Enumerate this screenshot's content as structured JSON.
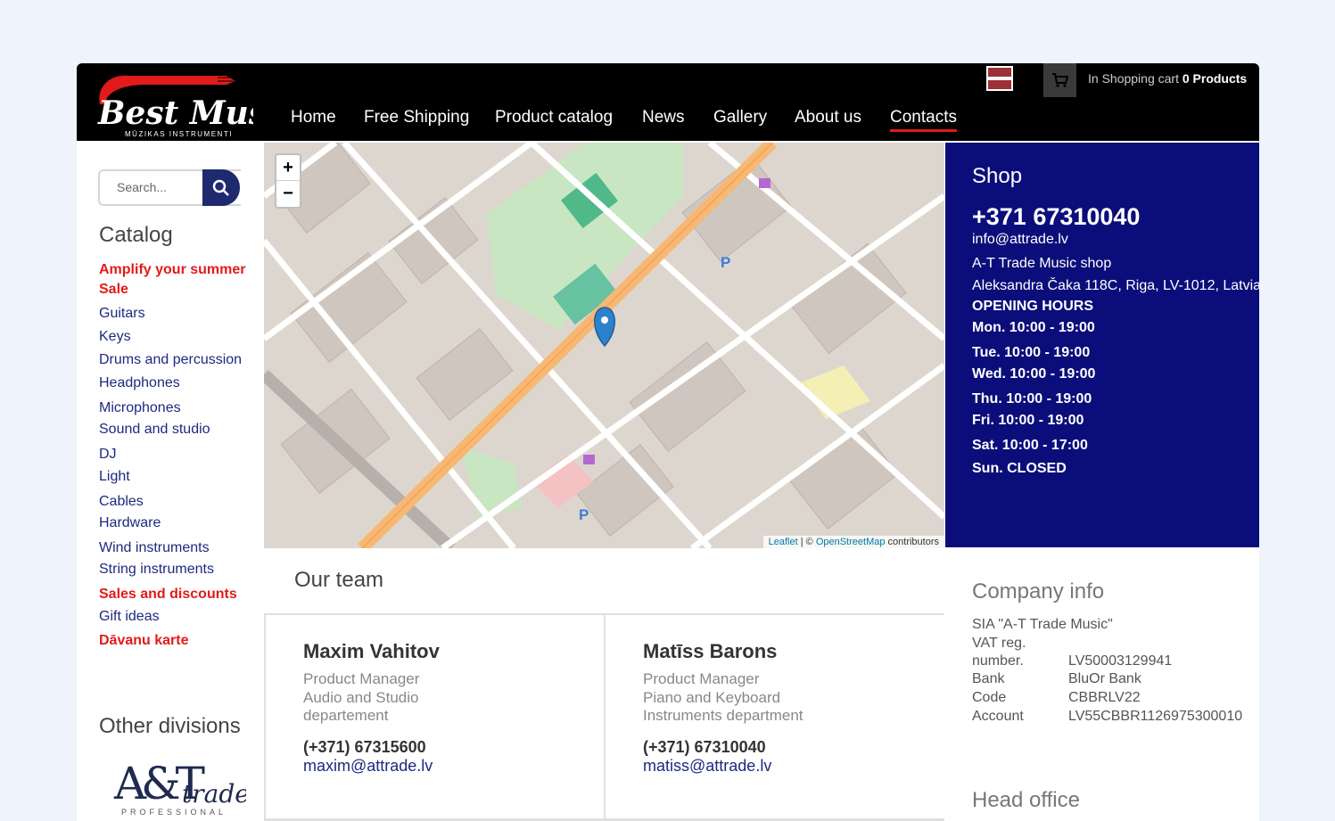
{
  "header": {
    "logo_text": "Best Music",
    "logo_subtext": "MŪZIKAS INSTRUMENTI",
    "nav": [
      "Home",
      "Free Shipping",
      "Product catalog",
      "News",
      "Gallery",
      "About us",
      "Contacts"
    ],
    "active_nav": "Contacts",
    "cart_label": "In Shopping cart",
    "cart_count": "0 Products",
    "language_flag": "latvia-flag"
  },
  "sidebar": {
    "search_placeholder": "Search...",
    "catalog_title": "Catalog",
    "catalog_items": [
      {
        "label": "Amplify your summer",
        "highlight": true
      },
      {
        "label": "Sale",
        "highlight": true
      },
      {
        "label": "Guitars",
        "highlight": false
      },
      {
        "label": "Keys",
        "highlight": false
      },
      {
        "label": "Drums and percussion",
        "highlight": false
      },
      {
        "label": "Headphones",
        "highlight": false
      },
      {
        "label": "Microphones",
        "highlight": false
      },
      {
        "label": "Sound and studio",
        "highlight": false
      },
      {
        "label": "DJ",
        "highlight": false
      },
      {
        "label": "Light",
        "highlight": false
      },
      {
        "label": "Cables",
        "highlight": false
      },
      {
        "label": "Hardware",
        "highlight": false
      },
      {
        "label": "Wind instruments",
        "highlight": false
      },
      {
        "label": "String instruments",
        "highlight": false
      },
      {
        "label": "Sales and discounts",
        "highlight": true
      },
      {
        "label": "Gift ideas",
        "highlight": false
      },
      {
        "label": "Dāvanu karte",
        "highlight": true
      }
    ],
    "divisions_title": "Other divisions",
    "division_logo_text": "A&T trade",
    "division_logo_sub": "PROFESSIONAL"
  },
  "map": {
    "zoom_in": "+",
    "zoom_out": "−",
    "attribution_leaflet": "Leaflet",
    "attribution_sep": " | © ",
    "attribution_osm": "OpenStreetMap",
    "attribution_suffix": " contributors"
  },
  "shop": {
    "title": "Shop",
    "phone": "+371 67310040",
    "email": "info@attrade.lv",
    "name": "A-T Trade Music shop",
    "address": "Aleksandra Čaka 118C, Riga, LV-1012, Latvia",
    "hours_title": "OPENING HOURS",
    "hours": [
      "Mon. 10:00 - 19:00",
      "Tue. 10:00 - 19:00",
      "Wed. 10:00 - 19:00",
      "Thu. 10:00 - 19:00",
      "Fri. 10:00 - 19:00",
      "Sat. 10:00 - 17:00",
      "Sun. CLOSED"
    ]
  },
  "team": {
    "title": "Our team",
    "members": [
      {
        "name": "Maxim Vahitov",
        "role": [
          "Product Manager",
          "Audio and Studio",
          "departement"
        ],
        "phone": "(+371) 67315600",
        "email": "maxim@attrade.lv"
      },
      {
        "name": "Matīss Barons",
        "role": [
          "Product Manager",
          "Piano and Keyboard",
          "Instruments department"
        ],
        "phone": "(+371) 67310040",
        "email": "matiss@attrade.lv"
      }
    ]
  },
  "company": {
    "title": "Company info",
    "name": "SIA \"A-T Trade Music\"",
    "vat_label_1": "VAT reg.",
    "vat_label_2": "number.",
    "vat_value": "LV50003129941",
    "bank_label": "Bank",
    "bank_value": "BluOr Bank",
    "code_label": "Code",
    "code_value": "CBBRLV22",
    "account_label": "Account",
    "account_value": "LV55CBBR1126975300010",
    "head_office_title": "Head office"
  },
  "colors": {
    "nav_bg": "#000000",
    "accent_red": "#e31a1a",
    "link_blue": "#1c2a7e",
    "shop_panel": "#0b0e7a"
  }
}
